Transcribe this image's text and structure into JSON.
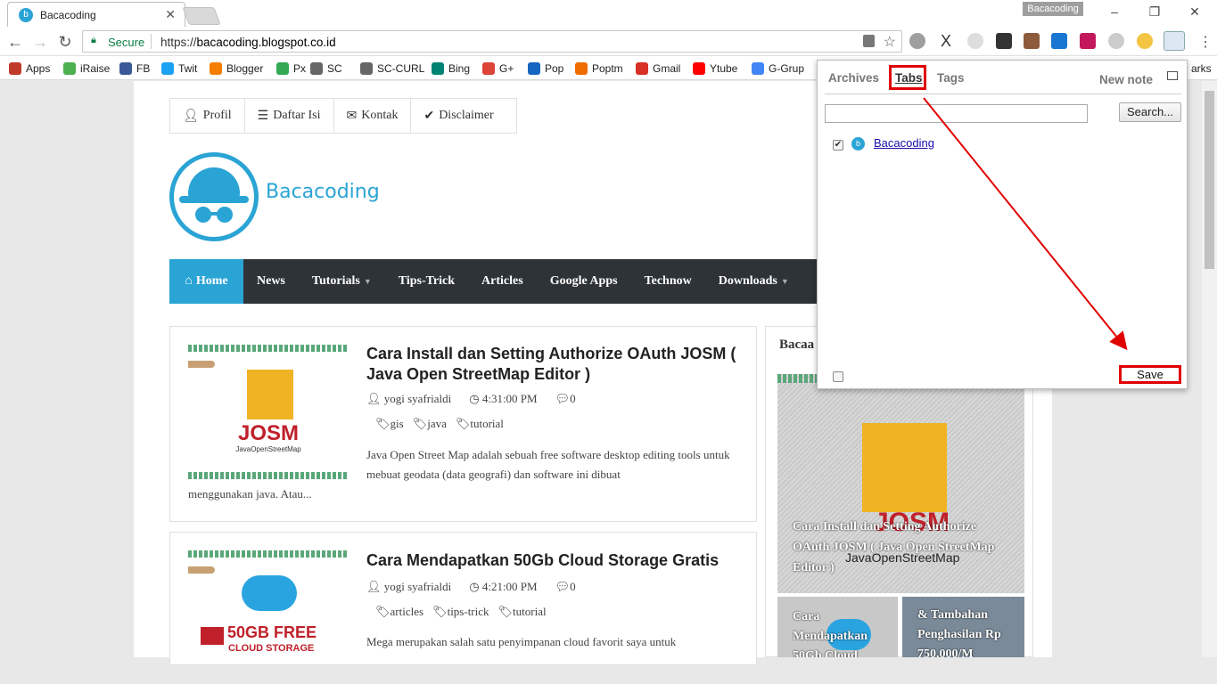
{
  "browser": {
    "tab_title": "Bacacoding",
    "tab_favicon": "b",
    "profile_badge": "Bacacoding",
    "secure_label": "Secure",
    "url_scheme": "https://",
    "url_host": "bacacoding.blogspot.co.id",
    "bookmarks": [
      {
        "label": "Apps",
        "icon": "apps-grid-icon",
        "color": "#c0392b"
      },
      {
        "label": "iRaise",
        "icon": "gear-icon",
        "color": "#4caf50"
      },
      {
        "label": "FB",
        "icon": "facebook-icon",
        "color": "#3b5998"
      },
      {
        "label": "Twit",
        "icon": "twitter-icon",
        "color": "#1da1f2"
      },
      {
        "label": "Blogger",
        "icon": "blogger-icon",
        "color": "#f57d00"
      },
      {
        "label": "Px",
        "icon": "500px-icon",
        "color": "#34a853"
      },
      {
        "label": "SC",
        "icon": "sc-icon",
        "color": "#666666"
      },
      {
        "label": "SC-CURL",
        "icon": "sc-curl-icon",
        "color": "#666666"
      },
      {
        "label": "Bing",
        "icon": "bing-icon",
        "color": "#008373"
      },
      {
        "label": "G+",
        "icon": "google-plus-icon",
        "color": "#db4437"
      },
      {
        "label": "Pop",
        "icon": "pop-icon",
        "color": "#1565c0"
      },
      {
        "label": "Poptm",
        "icon": "poptm-icon",
        "color": "#ef6c00"
      },
      {
        "label": "Gmail",
        "icon": "gmail-icon",
        "color": "#d93025"
      },
      {
        "label": "Ytube",
        "icon": "youtube-icon",
        "color": "#ff0000"
      },
      {
        "label": "G-Grup",
        "icon": "google-groups-icon",
        "color": "#4285f4"
      }
    ],
    "bookmarks_overflow": "arks"
  },
  "site": {
    "top_nav": [
      {
        "label": "Profil",
        "icon": "user-icon"
      },
      {
        "label": "Daftar Isi",
        "icon": "list-icon"
      },
      {
        "label": "Kontak",
        "icon": "envelope-icon"
      },
      {
        "label": "Disclaimer",
        "icon": "check-circle-icon"
      }
    ],
    "name": "Bacacoding",
    "main_nav": [
      {
        "label": "Home",
        "icon": "home-icon",
        "active": true,
        "dropdown": false
      },
      {
        "label": "News",
        "active": false,
        "dropdown": false
      },
      {
        "label": "Tutorials",
        "active": false,
        "dropdown": true
      },
      {
        "label": "Tips-Trick",
        "active": false,
        "dropdown": false
      },
      {
        "label": "Articles",
        "active": false,
        "dropdown": false
      },
      {
        "label": "Google Apps",
        "active": false,
        "dropdown": false
      },
      {
        "label": "Technow",
        "active": false,
        "dropdown": false
      },
      {
        "label": "Downloads",
        "active": false,
        "dropdown": true
      }
    ],
    "accent": "#2aa4d5"
  },
  "posts": [
    {
      "title": "Cara Install dan Setting Authorize OAuth JOSM ( Java Open StreetMap Editor )",
      "author": "yogi syafrialdi",
      "time": "4:31:00 PM",
      "comments": "0",
      "tags": [
        "gis",
        "java",
        "tutorial"
      ],
      "excerpt_a": "Java Open Street Map adalah sebuah free software desktop editing tools untuk mebuat geodata (data geografi) dan software ini dibuat",
      "excerpt_b": "menggunakan java.  Atau...",
      "thumb_title": "JOSM",
      "thumb_sub": "JavaOpenStreetMap"
    },
    {
      "title": "Cara Mendapatkan 50Gb Cloud Storage Gratis",
      "author": "yogi syafrialdi",
      "time": "4:21:00 PM",
      "comments": "0",
      "tags": [
        "articles",
        "tips-trick",
        "tutorial"
      ],
      "excerpt_a": "Mega merupakan salah satu penyimpanan cloud favorit saya untuk",
      "thumb_title": "50GB FREE",
      "thumb_sub": "CLOUD STORAGE"
    }
  ],
  "sidebar": {
    "title": "Bacaa",
    "big_caption": "Cara Install dan Setting Authorize OAuth JOSM ( Java Open StreetMap Editor )",
    "big_overlay_a": "JOSM",
    "big_overlay_b": "JavaOpenStreetMap",
    "small1_caption": "Cara Mendapatkan 50Gb Cloud",
    "small2_caption": "& Tambahan Penghasilan Rp 750.000/M"
  },
  "popup": {
    "tabs": [
      {
        "label": "Archives",
        "selected": false
      },
      {
        "label": "Tabs",
        "selected": true
      },
      {
        "label": "Tags",
        "selected": false
      }
    ],
    "new_note": "New note",
    "search_value": "",
    "search_button": "Search...",
    "items": [
      {
        "label": "Bacacoding",
        "checked": true
      }
    ],
    "save_button": "Save",
    "highlight_color": "#e00000"
  }
}
